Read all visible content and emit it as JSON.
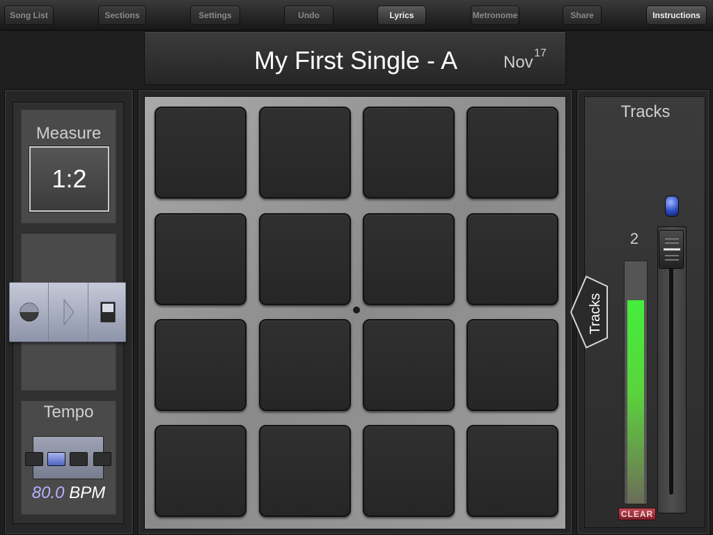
{
  "toolbar": {
    "buttons": [
      {
        "label": "Song List"
      },
      {
        "label": "Sections"
      },
      {
        "label": "Settings"
      },
      {
        "label": "Undo"
      },
      {
        "label": "Lyrics"
      },
      {
        "label": "Metronome"
      },
      {
        "label": "Share"
      },
      {
        "label": "Instructions"
      }
    ]
  },
  "header": {
    "song_title": "My First Single - A",
    "date_month": "Nov",
    "date_day": "17"
  },
  "left_panel": {
    "measure_label": "Measure",
    "measure_value": "1:2",
    "transport": {
      "record_icon": "record-icon",
      "play_icon": "play-icon",
      "stop_icon": "stop-icon"
    },
    "tempo_label": "Tempo",
    "tempo_selected_index": 2,
    "tempo_options_count": 4,
    "bpm_value": "80.0",
    "bpm_unit": "BPM"
  },
  "pads": {
    "rows": 4,
    "cols": 4
  },
  "right_panel": {
    "title": "Tracks",
    "tab_label": "Tracks",
    "track_count": "2",
    "meter_level": 0.84,
    "clear_label": "CLEAR",
    "fader_level": 1.0
  },
  "colors": {
    "meter_green": "#44ee3c",
    "bpm_value": "#b7b0ff",
    "clear_red": "#c24a55",
    "led_blue": "#2f4fc4"
  }
}
